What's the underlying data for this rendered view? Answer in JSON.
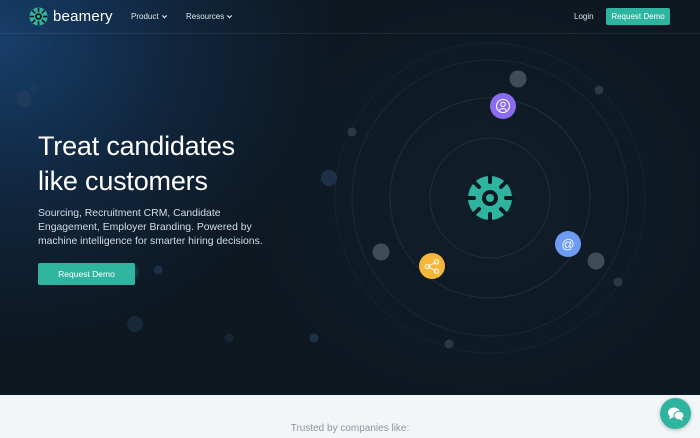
{
  "brand": {
    "name": "beamery",
    "accent": "#2fb4a0"
  },
  "nav": {
    "product_label": "Product",
    "resources_label": "Resources",
    "login_label": "Login",
    "cta_label": "Request Demo"
  },
  "hero": {
    "headline_line1": "Treat candidates",
    "headline_line2": "like customers",
    "subtext": "Sourcing, Recruitment CRM, Candidate Engagement, Employer Branding. Powered by machine intelligence for smarter hiring decisions.",
    "cta_label": "Request Demo"
  },
  "orbit_icons": [
    {
      "name": "user-icon",
      "color": "#8b6cf0"
    },
    {
      "name": "at-sign-icon",
      "color": "#6d9cf2"
    },
    {
      "name": "share-icon",
      "color": "#f5b63a"
    }
  ],
  "trusted": {
    "label": "Trusted by companies like:"
  },
  "chat": {
    "icon": "chat-icon"
  }
}
